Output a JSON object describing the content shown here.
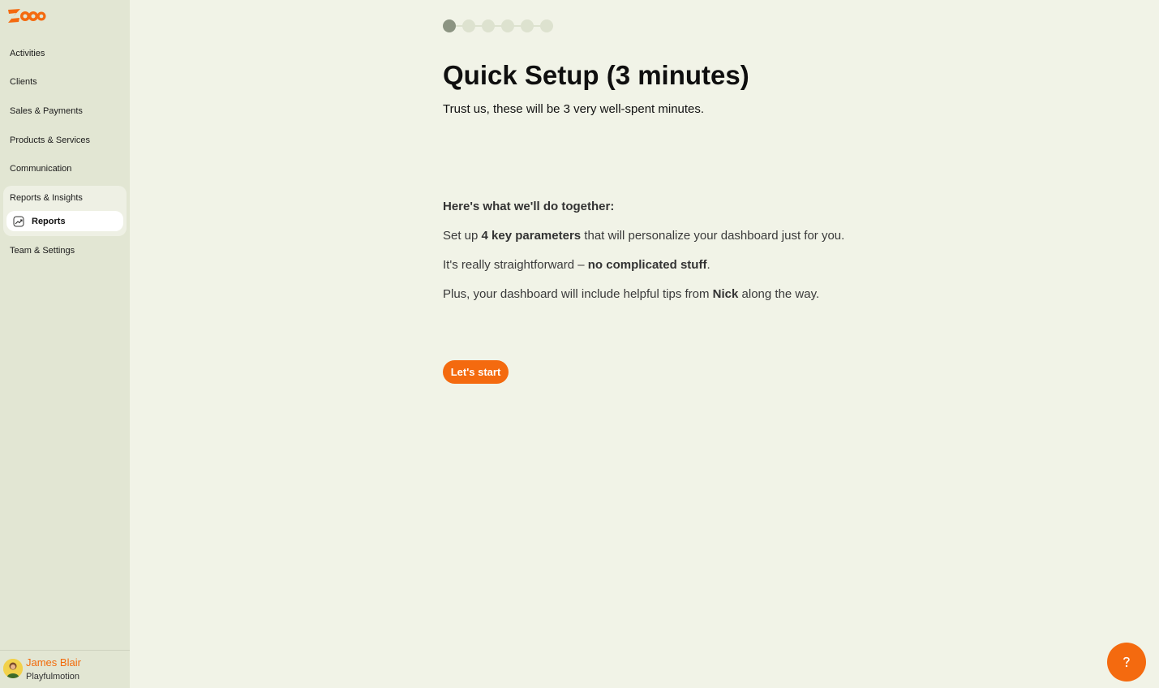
{
  "app": {
    "logo_text": "Zooo"
  },
  "sidebar": {
    "items": [
      {
        "label": "Activities"
      },
      {
        "label": "Clients"
      },
      {
        "label": "Sales & Payments"
      },
      {
        "label": "Products & Services"
      },
      {
        "label": "Communication"
      }
    ],
    "group": {
      "label": "Reports & Insights",
      "active_sub": "Reports"
    },
    "bottom_item": {
      "label": "Team & Settings"
    },
    "user": {
      "name": "James Blair",
      "organization": "Playfulmotion"
    }
  },
  "stepper": {
    "total_steps": 6,
    "current_step": 1
  },
  "main": {
    "title": "Quick Setup (3 minutes)",
    "subtitle": "Trust us, these will be 3 very well-spent minutes.",
    "section_heading": "Here's what we'll do together:",
    "line1": {
      "pre": "Set up ",
      "bold": "4 key parameters",
      "post": " that will personalize your dashboard just for you."
    },
    "line2": {
      "pre": "It's really straightforward – ",
      "bold": "no complicated stuff",
      "post": "."
    },
    "line3": {
      "pre": "Plus, your dashboard will include helpful tips from ",
      "bold": "Nick",
      "post": " along the way."
    },
    "cta_label": "Let's start"
  },
  "icons": {
    "reports": "chart-line-icon",
    "help": "question-icon"
  },
  "colors": {
    "accent": "#f46a0f",
    "sidebar_bg": "#e2e6d3",
    "page_bg": "#f1f3e7"
  }
}
